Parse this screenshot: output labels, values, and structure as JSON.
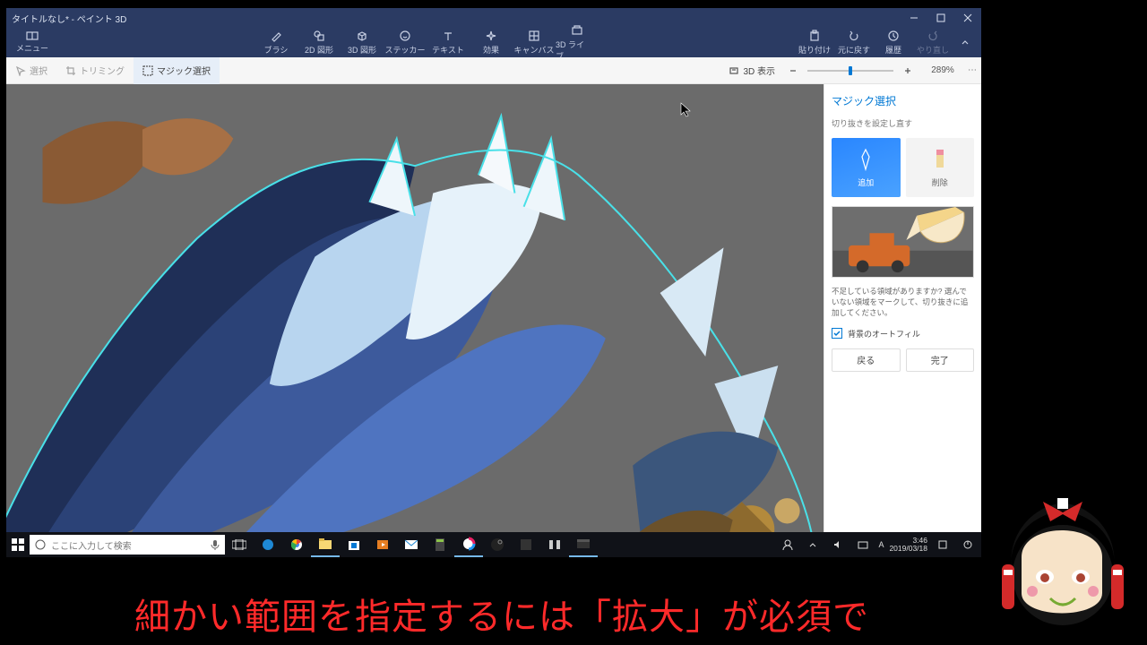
{
  "window": {
    "title": "タイトルなし* - ペイント 3D"
  },
  "ribbon": {
    "menu": "メニュー",
    "tools": [
      {
        "id": "brush",
        "label": "ブラシ"
      },
      {
        "id": "shapes2d",
        "label": "2D 図形"
      },
      {
        "id": "shapes3d",
        "label": "3D 図形"
      },
      {
        "id": "stickers",
        "label": "ステッカー"
      },
      {
        "id": "text",
        "label": "テキスト"
      },
      {
        "id": "effects",
        "label": "効果"
      },
      {
        "id": "canvas",
        "label": "キャンバス"
      },
      {
        "id": "lib3d",
        "label": "3D ライブ..."
      }
    ],
    "right": [
      {
        "id": "paste",
        "label": "貼り付け"
      },
      {
        "id": "undo",
        "label": "元に戻す"
      },
      {
        "id": "history",
        "label": "履歴"
      },
      {
        "id": "redo",
        "label": "やり直し",
        "dim": true
      }
    ]
  },
  "subbar": {
    "select": "選択",
    "trim": "トリミング",
    "magic": "マジック選択",
    "view3d": "3D 表示",
    "zoom_pct": "289%"
  },
  "panel": {
    "title": "マジック選択",
    "subtitle": "切り抜きを設定し直す",
    "add": "追加",
    "remove": "削除",
    "help": "不足している領域がありますか? 選んでいない領域をマークして、切り抜きに追加してください。",
    "autofill": "背景のオートフィル",
    "back": "戻る",
    "done": "完了"
  },
  "taskbar": {
    "search_placeholder": "ここに入力して検索",
    "time": "3:46",
    "date": "2019/03/18",
    "ime": "A"
  },
  "subtitle": "細かい範囲を指定するには「拡大」が必須で"
}
